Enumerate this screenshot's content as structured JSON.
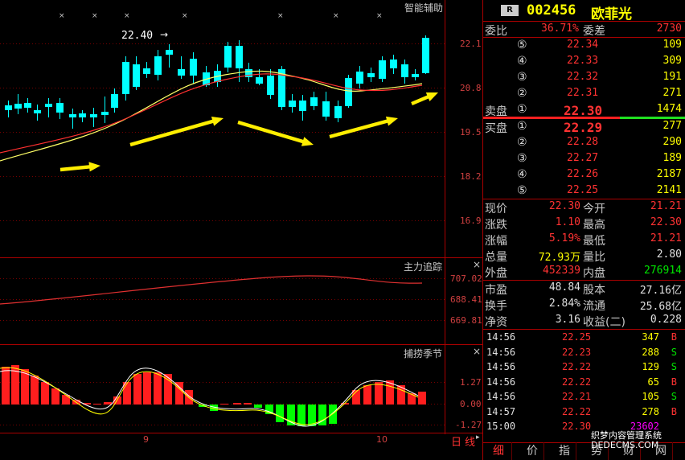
{
  "chart": {
    "main_panel_title": "智能辅助",
    "price_axis": [
      "22.1",
      "20.8",
      "19.5",
      "18.2",
      "16.9"
    ],
    "high_marker": "22.40",
    "sub1_title": "主力追踪",
    "sub1_axis": [
      "707.02",
      "688.41",
      "669.81"
    ],
    "sub2_title": "捕捞季节",
    "sub2_axis": [
      "1.27",
      "0.00",
      "-1.27"
    ],
    "x_labels": [
      "9",
      "10"
    ],
    "period_label": "日",
    "period_label2": "线",
    "colors": {
      "up": "#ff3232",
      "down": "#00ffff",
      "ma1": "#ffff66",
      "ma2": "#ff3030",
      "arrow": "#ffee00",
      "bar_up": "#ff1e1e",
      "bar_down": "#00ff00"
    }
  },
  "quote": {
    "badge": "R",
    "code": "002456",
    "name": "欧菲光",
    "weibi_label": "委比",
    "weibi_value": "36.71%",
    "weicha_label": "委差",
    "weicha_value": "2730",
    "asks": [
      {
        "level": "⑤",
        "price": "22.34",
        "vol": "109"
      },
      {
        "level": "④",
        "price": "22.33",
        "vol": "309"
      },
      {
        "level": "③",
        "price": "22.32",
        "vol": "191"
      },
      {
        "level": "②",
        "price": "22.31",
        "vol": "271"
      },
      {
        "level": "①",
        "price": "22.30",
        "vol": "1474"
      }
    ],
    "sell_label": "卖盘",
    "buy_label": "买盘",
    "bids": [
      {
        "level": "①",
        "price": "22.29",
        "vol": "277"
      },
      {
        "level": "②",
        "price": "22.28",
        "vol": "290"
      },
      {
        "level": "③",
        "price": "22.27",
        "vol": "189"
      },
      {
        "level": "④",
        "price": "22.26",
        "vol": "2187"
      },
      {
        "level": "⑤",
        "price": "22.25",
        "vol": "2141"
      }
    ],
    "stats": [
      {
        "l1": "现价",
        "v1": "22.30",
        "l2": "今开",
        "v2": "21.21"
      },
      {
        "l1": "涨跌",
        "v1": "1.10",
        "l2": "最高",
        "v2": "22.30"
      },
      {
        "l1": "涨幅",
        "v1": "5.19%",
        "l2": "最低",
        "v2": "21.21"
      },
      {
        "l1": "总量",
        "v1": "72.93万",
        "l2": "量比",
        "v2": "2.80"
      },
      {
        "l1": "外盘",
        "v1": "452339",
        "l2": "内盘",
        "v2": "276914"
      }
    ],
    "fundamentals": [
      {
        "l1": "市盈",
        "v1": "48.84",
        "l2": "股本",
        "v2": "27.16亿"
      },
      {
        "l1": "换手",
        "v1": "2.84%",
        "l2": "流通",
        "v2": "25.68亿"
      },
      {
        "l1": "净资",
        "v1": "3.16",
        "l2": "收益(二)",
        "v2": "0.228"
      }
    ],
    "ticks": [
      {
        "time": "14:56",
        "price": "22.25",
        "vol": "347",
        "side": "B"
      },
      {
        "time": "14:56",
        "price": "22.23",
        "vol": "288",
        "side": "S"
      },
      {
        "time": "14:56",
        "price": "22.22",
        "vol": "129",
        "side": "S"
      },
      {
        "time": "14:56",
        "price": "22.22",
        "vol": "65",
        "side": "B"
      },
      {
        "time": "14:56",
        "price": "22.21",
        "vol": "105",
        "side": "S"
      },
      {
        "time": "14:57",
        "price": "22.22",
        "vol": "278",
        "side": "B"
      },
      {
        "time": "15:00",
        "price": "22.30",
        "vol": "23602",
        "side": ""
      }
    ],
    "tabs": [
      "细",
      "价",
      "指",
      "势",
      "财",
      "网"
    ],
    "watermark": "织梦内容管理系统\nDEDECMS.COM"
  }
}
